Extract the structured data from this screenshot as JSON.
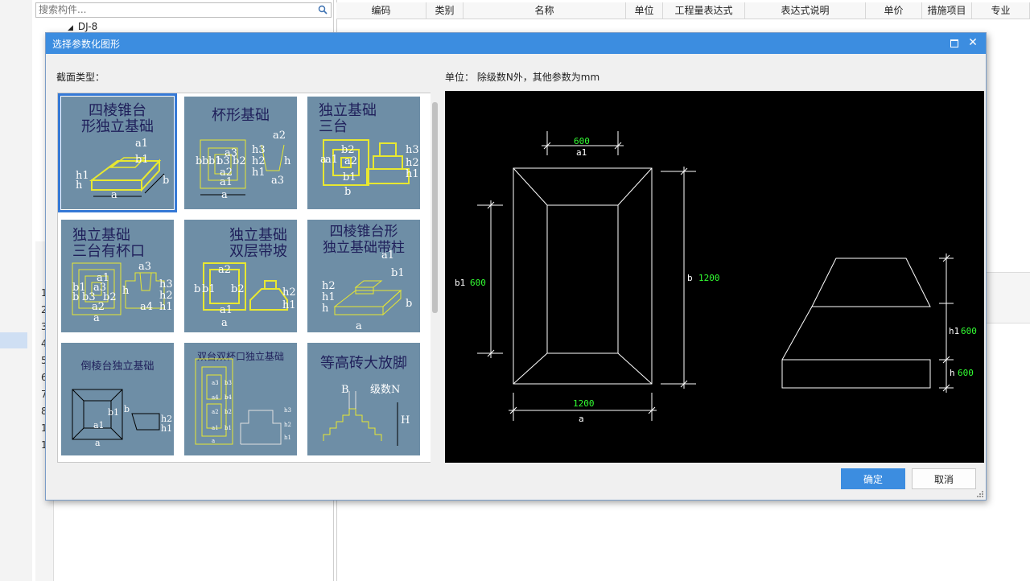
{
  "search": {
    "placeholder": "搜索构件..."
  },
  "tree": {
    "node_label": "DJ-8"
  },
  "row_numbers": [
    "1",
    "2",
    "3",
    "4",
    "5",
    "6",
    "7",
    "8",
    "1",
    "1"
  ],
  "grid_columns": [
    "编码",
    "类别",
    "名称",
    "单位",
    "工程量表达式",
    "表达式说明",
    "单价",
    "措施项目",
    "专业"
  ],
  "dialog": {
    "title": "选择参数化图形",
    "section_label": "截面类型：",
    "unit_note": "单位：  除级数N外，其他参数为mm",
    "ok_label": "确定",
    "cancel_label": "取消"
  },
  "thumbnails": [
    {
      "title_lines": [
        "四棱锥台",
        "形独立基础"
      ],
      "labels": [
        "a1",
        "b1",
        "h1",
        "h",
        "a",
        "b"
      ],
      "selected": true
    },
    {
      "title_lines": [
        "杯形基础"
      ],
      "labels": [
        "a2",
        "a3",
        "h3",
        "b",
        "b",
        "b1",
        "b3",
        "b2",
        "a2",
        "a1",
        "a",
        "h2",
        "h1",
        "h",
        "a3"
      ],
      "selected": false
    },
    {
      "title_lines": [
        "独立基础",
        "三台"
      ],
      "labels": [
        "a",
        "a1",
        "b2",
        "a2",
        "b1",
        "b",
        "h3",
        "h2",
        "h1"
      ],
      "selected": false
    },
    {
      "title_lines": [
        "独立基础",
        "三台有杯口"
      ],
      "labels": [
        "a3",
        "a1",
        "b1",
        "a3",
        "b",
        "b3",
        "b2",
        "a2",
        "a",
        "h",
        "h3",
        "h2",
        "h1",
        "a4"
      ],
      "selected": false
    },
    {
      "title_lines": [
        "独立基础",
        "双层带坡"
      ],
      "labels": [
        "a2",
        "b",
        "b1",
        "b2",
        "a1",
        "a",
        "h2",
        "h1"
      ],
      "selected": false
    },
    {
      "title_lines": [
        "四棱锥台形",
        "独立基础带柱"
      ],
      "labels": [
        "a1",
        "b1",
        "h2",
        "h1",
        "h",
        "a",
        "b"
      ],
      "selected": false
    },
    {
      "title_lines": [
        "倒棱台独立基础"
      ],
      "labels": [
        "b1",
        "a1",
        "a",
        "b",
        "h2",
        "h1"
      ],
      "selected": false
    },
    {
      "title_lines": [
        "双台双杯口独立基础"
      ],
      "labels": [
        "a3",
        "b3",
        "a4",
        "b4",
        "a2",
        "b2",
        "a1",
        "b1",
        "a",
        "h3",
        "h2",
        "h1"
      ],
      "selected": false
    },
    {
      "title_lines": [
        "等高砖大放脚"
      ],
      "labels": [
        "B",
        "级数N",
        "H"
      ],
      "selected": false
    }
  ],
  "preview": {
    "top_dim_value": "600",
    "top_dim_label": "a1",
    "left_dim_label": "b1",
    "left_dim_value": "600",
    "right_dim_label": "b",
    "right_dim_value": "1200",
    "bottom_dim_value": "1200",
    "bottom_dim_label": "a",
    "h1_label": "h1",
    "h1_value": "600",
    "h_label": "h",
    "h_value": "600",
    "line_color": "#ffffff",
    "value_color": "#33ff33"
  }
}
